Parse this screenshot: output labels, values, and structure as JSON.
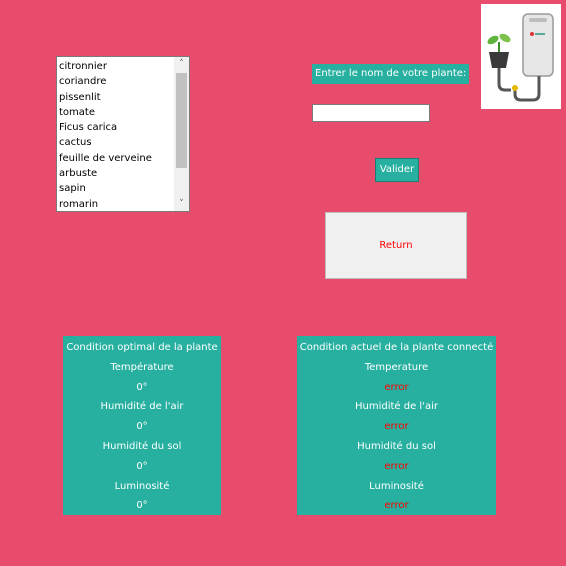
{
  "plant_list": {
    "items": [
      "citronnier",
      "coriandre",
      "pissenlit",
      "tomate",
      "Ficus carica",
      "cactus",
      "feuille de verveine",
      "arbuste",
      "sapin",
      "romarin"
    ]
  },
  "search": {
    "prompt_label": "Entrer le nom de votre plante:",
    "input_value": "",
    "validate_label": "Valider"
  },
  "return_button": {
    "label": "Return"
  },
  "optimal_panel": {
    "title": "Condition optimal de la plante",
    "temperature_label": "Température",
    "temperature_value": "0°",
    "air_humidity_label": "Humidité de l'air",
    "air_humidity_value": "0°",
    "soil_humidity_label": "Humidité du sol",
    "soil_humidity_value": "0°",
    "luminosity_label": "Luminosité",
    "luminosity_value": "0°"
  },
  "current_panel": {
    "title": "Condition actuel de la plante connecté",
    "temperature_label": "Temperature",
    "temperature_value": "error",
    "air_humidity_label": "Humidité de l'air",
    "air_humidity_value": "error",
    "soil_humidity_label": "Humidité du sol",
    "soil_humidity_value": "error",
    "luminosity_label": "Luminosité",
    "luminosity_value": "error"
  },
  "icons": {
    "scroll_up": "chevron-up-icon",
    "scroll_down": "chevron-down-icon",
    "logo": "plant-sensor-logo"
  },
  "colors": {
    "background": "#e84c6c",
    "accent": "#27b0a0",
    "error": "#ff0000"
  }
}
